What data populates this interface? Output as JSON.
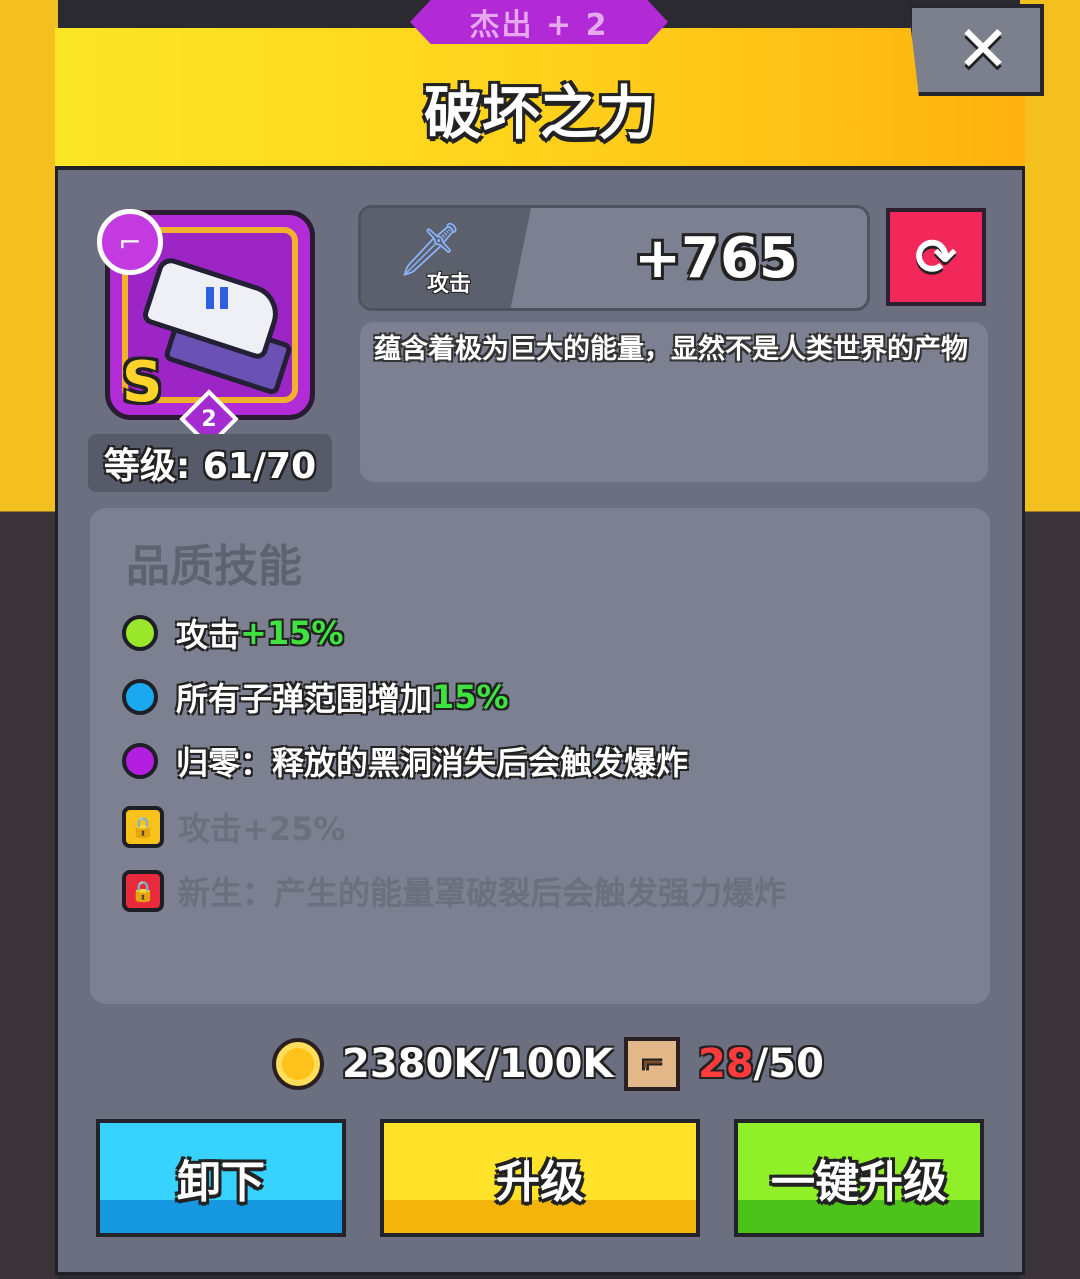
{
  "header": {
    "rarity_label": "杰出 + 2",
    "title": "破坏之力",
    "close_symbol": "✕"
  },
  "item": {
    "type_icon": "pistol-icon",
    "grade": "S",
    "stars": "2",
    "level_text": "等级: 61/70"
  },
  "stat": {
    "label": "攻击",
    "value": "+765",
    "icon": "sword-icon"
  },
  "description": "蕴含着极为巨大的能量，显然不是人类世界的产物",
  "skills": {
    "title": "品质技能",
    "items": [
      {
        "text": "攻击",
        "bonus": "+15%",
        "color": "#9ae62a",
        "locked": false
      },
      {
        "text": "所有子弹范围增加",
        "bonus": "15%",
        "color": "#1aa8f0",
        "locked": false
      },
      {
        "text": "归零：释放的黑洞消失后会触发爆炸",
        "bonus": "",
        "color": "#b41ee0",
        "locked": false
      },
      {
        "text": "攻击+25%",
        "bonus": "",
        "color": "#f8c21a",
        "locked": true
      },
      {
        "text": "新生：产生的能量罩破裂后会触发强力爆炸",
        "bonus": "",
        "color": "#e82a3a",
        "locked": true
      }
    ]
  },
  "resources": {
    "coins": "2380K/100K",
    "scrolls_current": "28",
    "scrolls_total": "/50"
  },
  "buttons": {
    "unequip": "卸下",
    "upgrade": "升级",
    "upgrade_all": "一键升级"
  },
  "colors": {
    "header_yellow": "#ffd21c",
    "rarity_purple": "#b12ad6",
    "refresh_red": "#f2285a",
    "btn_blue": "#38d2ff",
    "btn_yellow": "#ffe22a",
    "btn_green": "#8ff02a"
  }
}
